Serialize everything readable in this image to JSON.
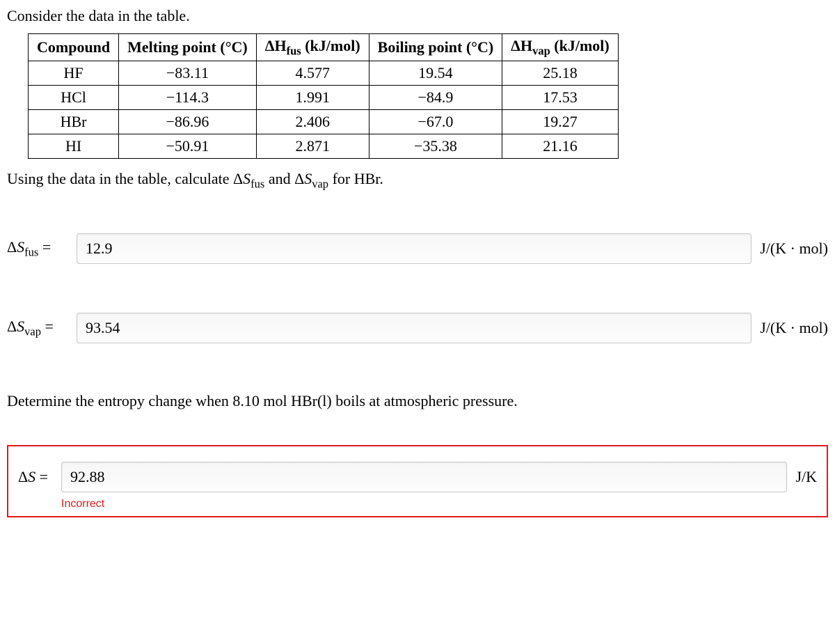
{
  "prompt_intro": "Consider the data in the table.",
  "table": {
    "headers": {
      "compound": "Compound",
      "mp": "Melting point (°C)",
      "hfus_pre": "ΔH",
      "hfus_sub": "fus",
      "hfus_post": " (kJ/mol)",
      "bp": "Boiling point (°C)",
      "hvap_pre": "ΔH",
      "hvap_sub": "vap",
      "hvap_post": " (kJ/mol)"
    },
    "rows": [
      {
        "c": "HF",
        "mp": "−83.11",
        "hfus": "4.577",
        "bp": "19.54",
        "hvap": "25.18"
      },
      {
        "c": "HCl",
        "mp": "−114.3",
        "hfus": "1.991",
        "bp": "−84.9",
        "hvap": "17.53"
      },
      {
        "c": "HBr",
        "mp": "−86.96",
        "hfus": "2.406",
        "bp": "−67.0",
        "hvap": "19.27"
      },
      {
        "c": "HI",
        "mp": "−50.91",
        "hfus": "2.871",
        "bp": "−35.38",
        "hvap": "21.16"
      }
    ]
  },
  "instruction": {
    "pre": "Using the data in the table, calculate Δ",
    "s1": "S",
    "sub1": "fus",
    "mid": " and Δ",
    "s2": "S",
    "sub2": "vap",
    "post": " for HBr."
  },
  "answer_fus": {
    "label_pre": "Δ",
    "label_s": "S",
    "label_sub": "fus",
    "label_eq": " =",
    "value": "12.9",
    "unit": "J/(K · mol)"
  },
  "answer_vap": {
    "label_pre": "Δ",
    "label_s": "S",
    "label_sub": "vap",
    "label_eq": " =",
    "value": "93.54",
    "unit": "J/(K · mol)"
  },
  "q2": "Determine the entropy change when 8.10 mol HBr(l) boils at atmospheric pressure.",
  "answer_ds": {
    "label_pre": "Δ",
    "label_s": "S",
    "label_eq": " =",
    "value": "92.88",
    "unit": "J/K",
    "status": "Incorrect"
  }
}
